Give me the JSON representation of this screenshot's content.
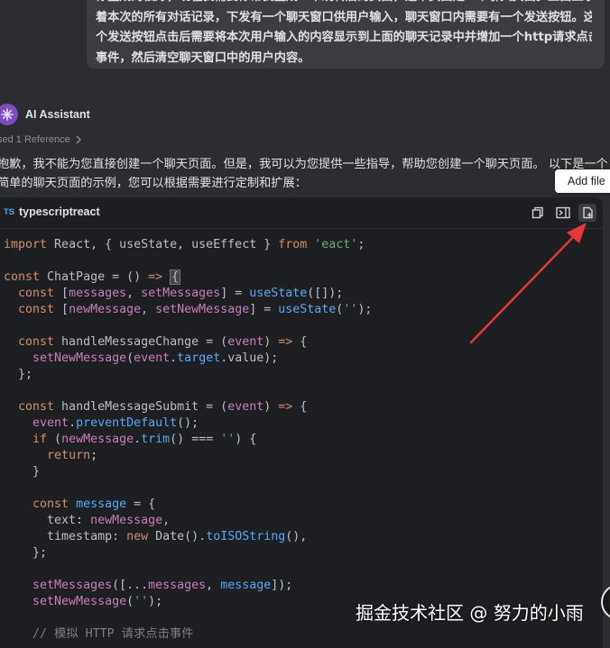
{
  "user_message": {
    "lines": [
      "你生成的很好，现在我需要你帮我生成一个跳转后的页面，这个页面是一个聊天页面。上面显示",
      "着本次的所有对话记录，下发有一个聊天窗口供用户输入，聊天窗口内需要有一个发送按钮。这",
      "个发送按钮点击后需要将本次用户输入的内容显示到上面的聊天记录中并增加一个http请求点击",
      "事件，然后清空聊天窗口中的用户内容。"
    ]
  },
  "assistant": {
    "name": "AI Assistant",
    "avatar_icon": "sparkle-icon",
    "reference_label": "sed 1 Reference",
    "reply_lines": [
      "抱歉，我不能为您直接创建一个聊天页面。但是，我可以为您提供一些指导，帮助您创建一个聊天页面。 以下是一个",
      "简单的聊天页面的示例，您可以根据需要进行定制和扩展："
    ]
  },
  "code_block": {
    "language": "typescriptreact",
    "language_badge": "TS",
    "actions": [
      {
        "name": "copy",
        "icon": "copy-icon"
      },
      {
        "name": "insert",
        "icon": "insert-snippet-icon"
      },
      {
        "name": "add-file",
        "icon": "add-file-icon"
      }
    ],
    "tooltip": "Add file",
    "line_count": 25
  },
  "watermark": "掘金技术社区 @ 努力的小雨",
  "colors": {
    "background": "#2b2d30",
    "bubble": "#3b3d41",
    "code_bg": "#1e1f22",
    "keyword": "#cf8e6d",
    "function": "#56a8f5",
    "variable": "#c77dbb",
    "string": "#6aab73",
    "arrow": "#e53935"
  }
}
